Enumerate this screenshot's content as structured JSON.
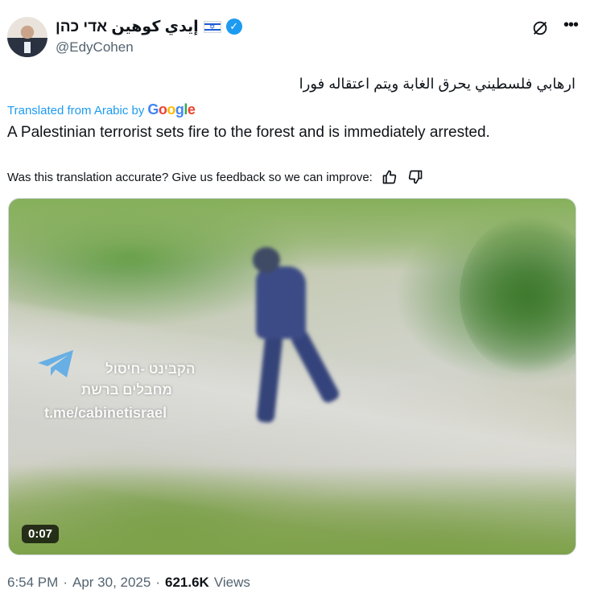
{
  "author": {
    "display_name": "إيدي كوهين אדי כהן",
    "flag_icon": "israel-flag-icon",
    "verified_icon": "verified-badge-icon",
    "verified_color": "#1d9bf0",
    "handle": "@EdyCohen"
  },
  "actions": {
    "grok_icon": "grok-icon",
    "more_icon": "more-icon"
  },
  "tweet": {
    "original_text": "ارهابي فلسطيني يحرق الغابة ويتم اعتقاله فورا",
    "translated_from": "Translated from Arabic by",
    "translator_brand": [
      "G",
      "o",
      "o",
      "g",
      "l",
      "e"
    ],
    "translation": "A Palestinian terrorist sets fire to the forest and is immediately arrested."
  },
  "feedback": {
    "prompt": "Was this translation accurate? Give us feedback so we can improve:",
    "thumbs_up_icon": "thumbs-up-icon",
    "thumbs_down_icon": "thumbs-down-icon"
  },
  "media": {
    "watermark_line1": "הקבינט -חיסול",
    "watermark_line2": "מחבלים ברשת",
    "watermark_line3": "t.me/cabinetisrael",
    "telegram_icon": "telegram-icon",
    "duration": "0:07"
  },
  "meta": {
    "time": "6:54 PM",
    "separator": "·",
    "date": "Apr 30, 2025",
    "views_count": "621.6K",
    "views_label": "Views"
  },
  "colors": {
    "link_blue": "#1d9bf0",
    "secondary_text": "#536471",
    "primary_text": "#0f1419"
  }
}
